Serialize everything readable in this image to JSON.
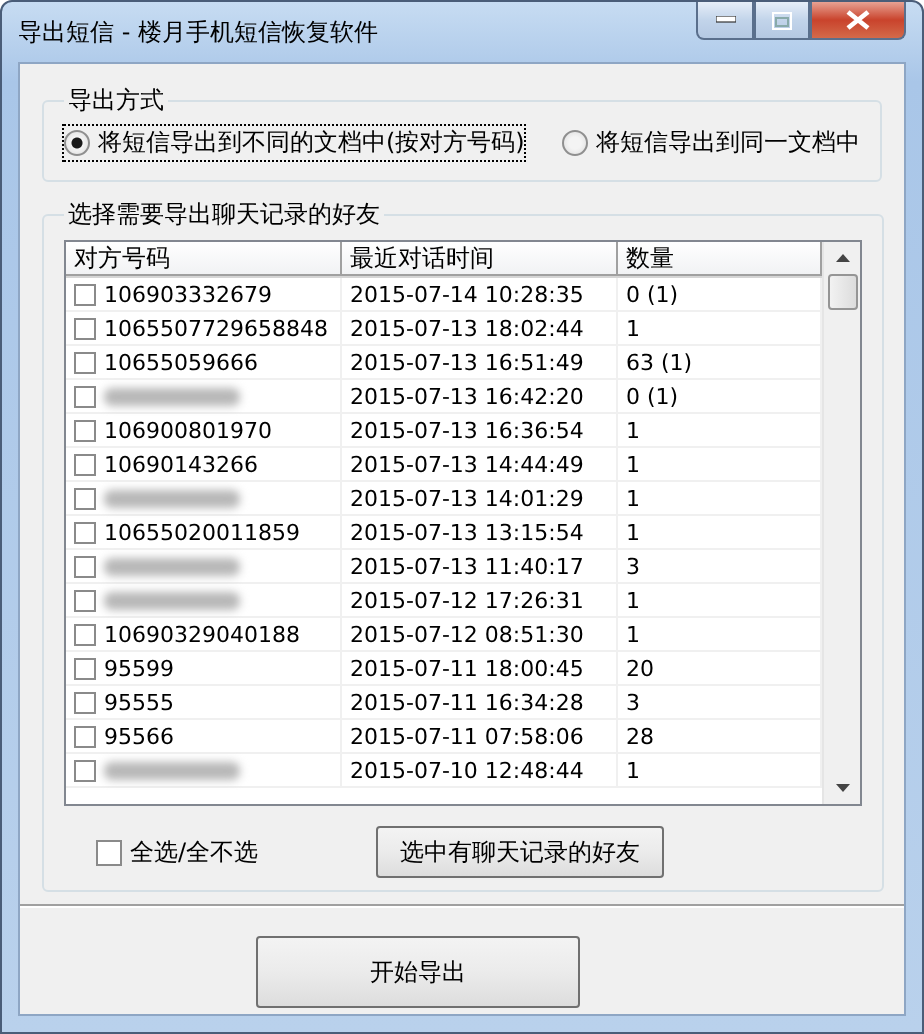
{
  "window": {
    "title": "导出短信 - 楼月手机短信恢复软件"
  },
  "export_mode": {
    "title": "导出方式",
    "options": [
      {
        "label": "将短信导出到不同的文档中(按对方号码)",
        "selected": true
      },
      {
        "label": "将短信导出到同一文档中",
        "selected": false
      }
    ]
  },
  "friends": {
    "title": "选择需要导出聊天记录的好友",
    "columns": [
      "对方号码",
      "最近对话时间",
      "数量"
    ],
    "rows": [
      {
        "number": "106903332679",
        "blurred": false,
        "time": "2015-07-14 10:28:35",
        "count": "0 (1)",
        "checked": false
      },
      {
        "number": "1065507729658848",
        "blurred": false,
        "time": "2015-07-13 18:02:44",
        "count": "1",
        "checked": false
      },
      {
        "number": "10655059666",
        "blurred": false,
        "time": "2015-07-13 16:51:49",
        "count": "63 (1)",
        "checked": false
      },
      {
        "blurred": true,
        "time": "2015-07-13 16:42:20",
        "count": "0 (1)",
        "checked": false
      },
      {
        "number": "106900801970",
        "blurred": false,
        "time": "2015-07-13 16:36:54",
        "count": "1",
        "checked": false
      },
      {
        "number": "10690143266",
        "blurred": false,
        "time": "2015-07-13 14:44:49",
        "count": "1",
        "checked": false
      },
      {
        "blurred": true,
        "time": "2015-07-13 14:01:29",
        "count": "1",
        "checked": false
      },
      {
        "number": "10655020011859",
        "blurred": false,
        "time": "2015-07-13 13:15:54",
        "count": "1",
        "checked": false
      },
      {
        "blurred": true,
        "time": "2015-07-13 11:40:17",
        "count": "3",
        "checked": false
      },
      {
        "blurred": true,
        "time": "2015-07-12 17:26:31",
        "count": "1",
        "checked": false
      },
      {
        "number": "10690329040188",
        "blurred": false,
        "time": "2015-07-12 08:51:30",
        "count": "1",
        "checked": false
      },
      {
        "number": "95599",
        "blurred": false,
        "time": "2015-07-11 18:00:45",
        "count": "20",
        "checked": false
      },
      {
        "number": "95555",
        "blurred": false,
        "time": "2015-07-11 16:34:28",
        "count": "3",
        "checked": false
      },
      {
        "number": "95566",
        "blurred": false,
        "time": "2015-07-11 07:58:06",
        "count": "28",
        "checked": false
      },
      {
        "blurred": true,
        "time": "2015-07-10 12:48:44",
        "count": "1",
        "checked": false
      }
    ],
    "select_all": {
      "label": "全选/全不选",
      "checked": false
    },
    "select_with_chats_button": "选中有聊天记录的好友"
  },
  "start_button": "开始导出"
}
